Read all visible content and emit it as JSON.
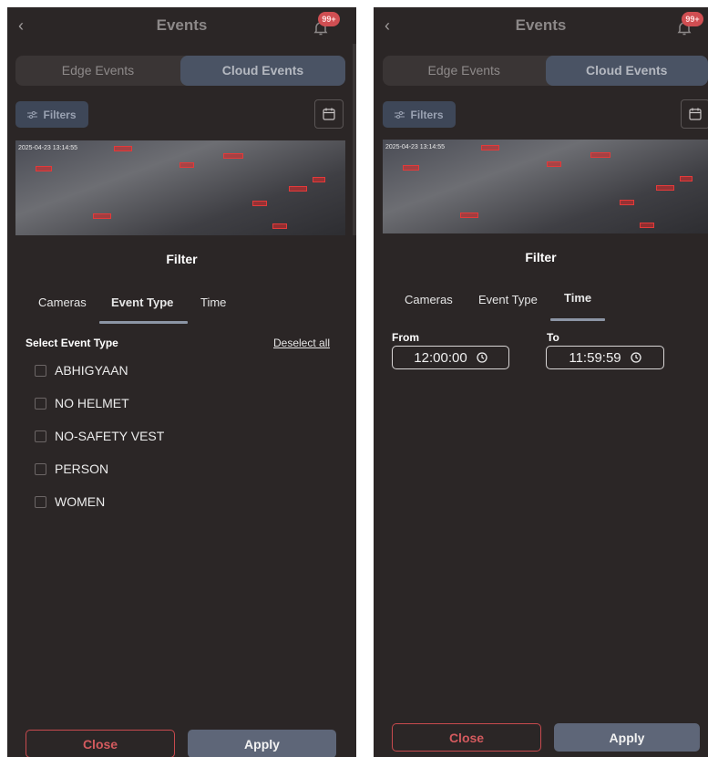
{
  "common": {
    "back_icon": "chevron-left-icon",
    "title": "Events",
    "badge": "99+",
    "bell_icon": "bell-icon",
    "tabs": [
      "Edge Events",
      "Cloud Events"
    ],
    "filters_label": "Filters",
    "filters_icon": "sliders-icon",
    "calendar_icon": "calendar-icon",
    "camera_timestamp": "2025-04-23 13:14:55",
    "sheet_title": "Filter",
    "filter_tabs": [
      "Cameras",
      "Event Type",
      "Time"
    ],
    "close_label": "Close",
    "apply_label": "Apply",
    "colors": {
      "background": "#2b2626",
      "active_tab": "#4a5364",
      "badge": "#d04e52",
      "close_border": "#c84a4e",
      "apply_bg": "#5e6678"
    }
  },
  "left": {
    "active_filter_tab": "Event Type",
    "select_label": "Select Event Type",
    "deselect_label": "Deselect all",
    "event_types": [
      "ABHIGYAAN",
      "NO HELMET",
      "NO-SAFETY VEST",
      "PERSON",
      "WOMEN"
    ]
  },
  "right": {
    "active_filter_tab": "Time",
    "from_label": "From",
    "from_value": "12:00:00",
    "to_label": "To",
    "to_value": "11:59:59",
    "clock_icon": "clock-icon"
  }
}
